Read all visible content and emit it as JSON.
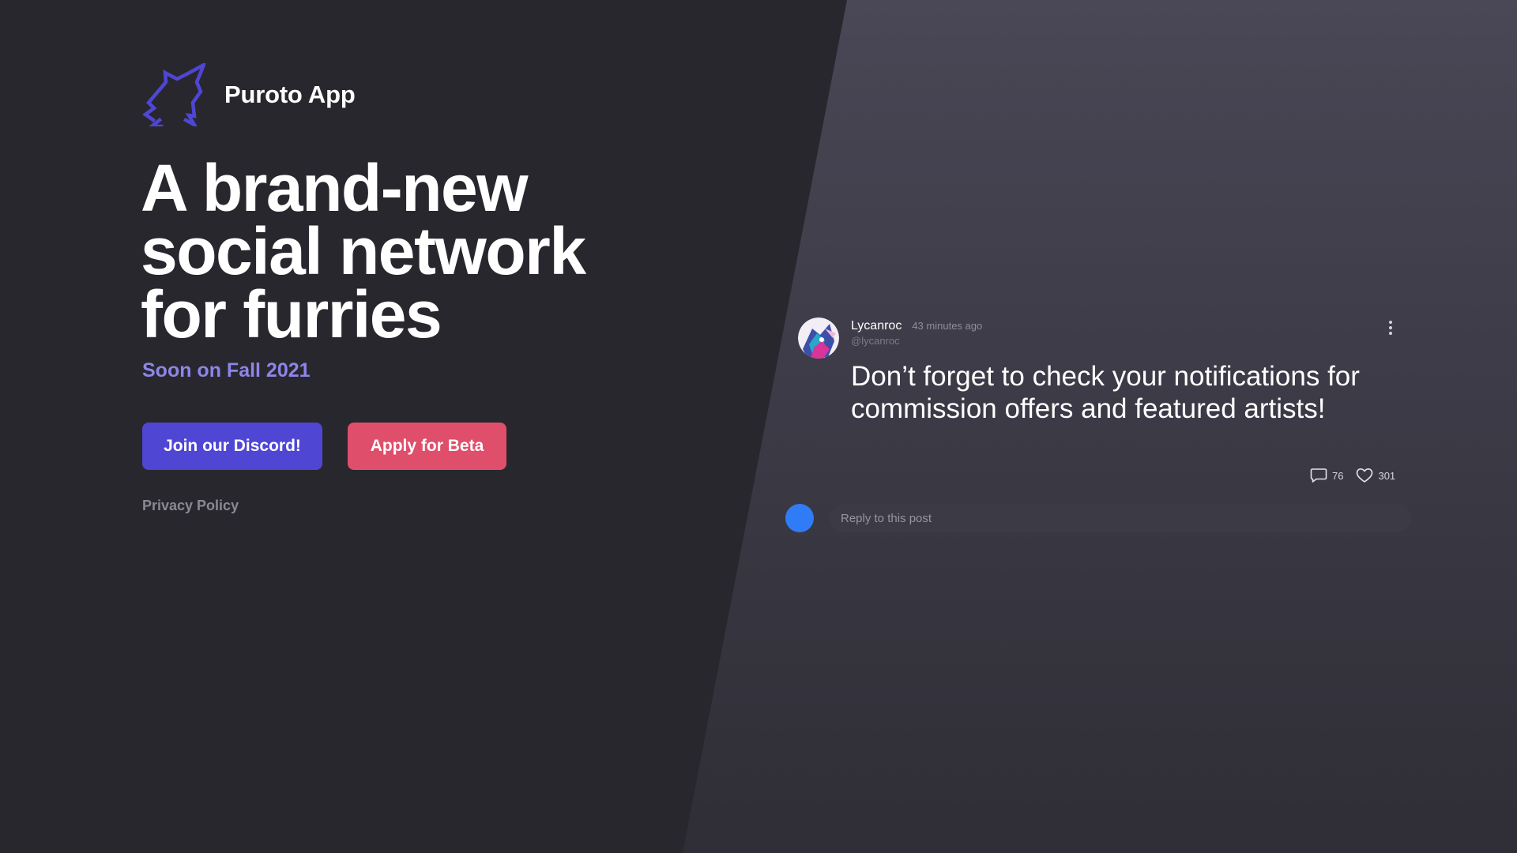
{
  "brand": {
    "name": "Puroto App",
    "logo_icon": "wolf-head-logo-icon",
    "logo_color": "#4f46d4"
  },
  "hero": {
    "headline_lines": [
      "A brand-new",
      "social network",
      "for furries"
    ],
    "tagline": "Soon on Fall 2021"
  },
  "actions": {
    "discord_label": "Join our Discord!",
    "beta_label": "Apply for Beta",
    "privacy_label": "Privacy Policy"
  },
  "post": {
    "author_name": "Lycanroc",
    "author_handle": "@lycanroc",
    "time_ago": "43 minutes ago",
    "body": "Don’t forget to check your notifications for commission offers and featured artists!",
    "comments_count": "76",
    "likes_count": "301",
    "comment_icon": "comment-icon",
    "like_icon": "heart-icon",
    "more_icon": "more-vertical-icon"
  },
  "reply": {
    "placeholder": "Reply to this post"
  },
  "colors": {
    "background": "#28272e",
    "panel": "#4a4756",
    "primary": "#4f46d4",
    "accent": "#df4f6b",
    "tagline": "#8d85e8",
    "reply_avatar": "#2f7cf6"
  }
}
